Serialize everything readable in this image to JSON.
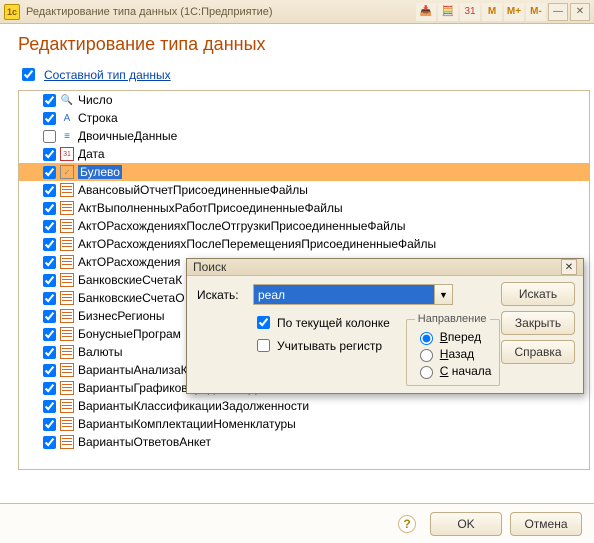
{
  "titlebar": {
    "text": "Редактирование типа данных  (1С:Предприятие)"
  },
  "header": "Редактирование типа данных",
  "composite": {
    "label": "Составной тип данных"
  },
  "tree": {
    "items": [
      {
        "checked": true,
        "icon": "num",
        "label": "Число"
      },
      {
        "checked": true,
        "icon": "str",
        "label": "Строка"
      },
      {
        "checked": false,
        "icon": "bin",
        "label": "ДвоичныеДанные"
      },
      {
        "checked": true,
        "icon": "date",
        "label": "Дата"
      },
      {
        "checked": true,
        "icon": "bool",
        "label": "Булево",
        "selected": true
      },
      {
        "checked": true,
        "icon": "table",
        "label": "АвансовыйОтчетПрисоединенныеФайлы"
      },
      {
        "checked": true,
        "icon": "table",
        "label": "АктВыполненныхРаботПрисоединенныеФайлы"
      },
      {
        "checked": true,
        "icon": "table",
        "label": "АктОРасхожденияхПослеОтгрузкиПрисоединенныеФайлы"
      },
      {
        "checked": true,
        "icon": "table",
        "label": "АктОРасхожденияхПослеПеремещенияПрисоединенныеФайлы"
      },
      {
        "checked": true,
        "icon": "table",
        "label": "АктОРасхождения"
      },
      {
        "checked": true,
        "icon": "table",
        "label": "БанковскиеСчетаК"
      },
      {
        "checked": true,
        "icon": "table",
        "label": "БанковскиеСчетаО"
      },
      {
        "checked": true,
        "icon": "table",
        "label": "БизнесРегионы"
      },
      {
        "checked": true,
        "icon": "table",
        "label": "БонусныеПрограм"
      },
      {
        "checked": true,
        "icon": "table",
        "label": "Валюты"
      },
      {
        "checked": true,
        "icon": "table",
        "label": "ВариантыАнализаК"
      },
      {
        "checked": true,
        "icon": "table",
        "label": "ВариантыГрафиковКредитовИДепозитов"
      },
      {
        "checked": true,
        "icon": "table",
        "label": "ВариантыКлассификацииЗадолженности"
      },
      {
        "checked": true,
        "icon": "table",
        "label": "ВариантыКомплектацииНоменклатуры"
      },
      {
        "checked": true,
        "icon": "table",
        "label": "ВариантыОтветовАнкет"
      }
    ]
  },
  "search": {
    "title": "Поиск",
    "field_label": "Искать:",
    "value": "реал",
    "by_column": "По текущей колонке",
    "match_case": "Учитывать регистр",
    "direction": {
      "legend": "Направление",
      "forward": "Вперед",
      "back": "Назад",
      "from_start": "С начала"
    },
    "buttons": {
      "find": "Искать",
      "close": "Закрыть",
      "help": "Справка"
    }
  },
  "footer": {
    "ok": "OK",
    "cancel": "Отмена"
  }
}
